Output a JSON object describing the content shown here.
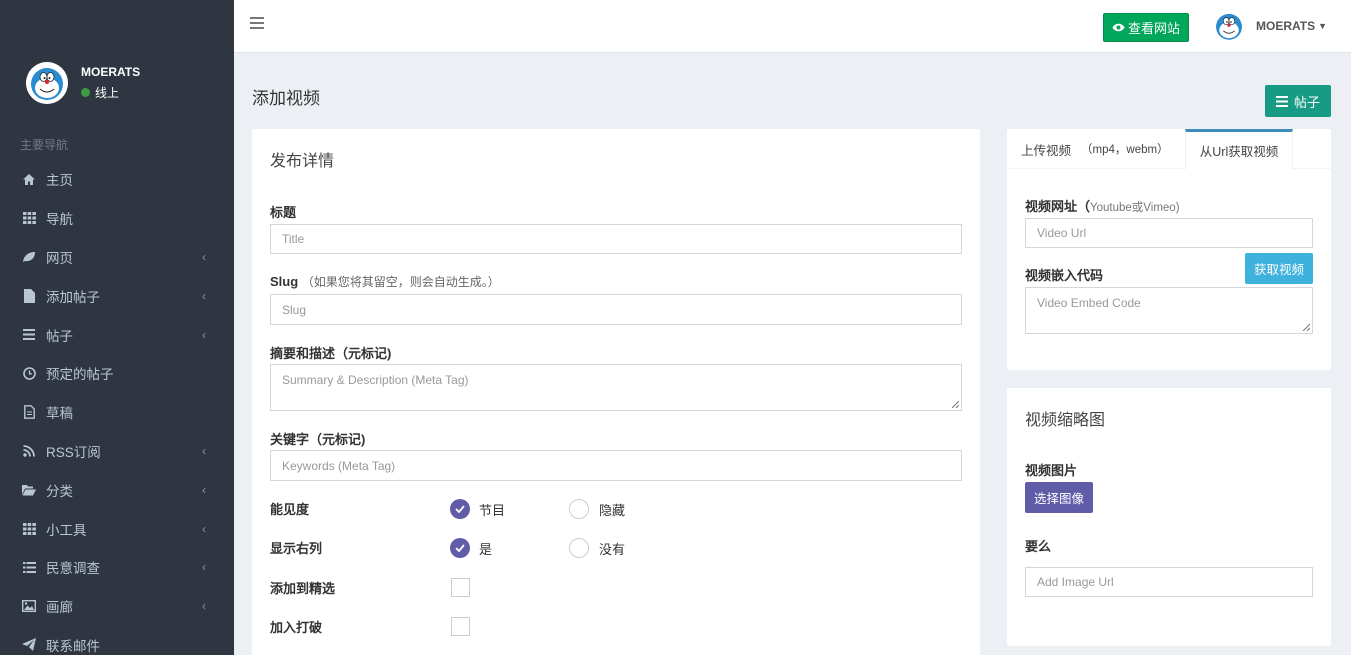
{
  "sidebar": {
    "user_name": "MOERATS",
    "status": "线上",
    "nav_header": "主要导航",
    "items": [
      {
        "label": "主页",
        "icon": "home-icon",
        "has_children": false
      },
      {
        "label": "导航",
        "icon": "grid-icon",
        "has_children": false
      },
      {
        "label": "网页",
        "icon": "leaf-icon",
        "has_children": true
      },
      {
        "label": "添加帖子",
        "icon": "file-icon",
        "has_children": true
      },
      {
        "label": "帖子",
        "icon": "bars-icon",
        "has_children": true
      },
      {
        "label": "预定的帖子",
        "icon": "clock-icon",
        "has_children": false
      },
      {
        "label": "草稿",
        "icon": "file-text-icon",
        "has_children": false
      },
      {
        "label": "RSS订阅",
        "icon": "rss-icon",
        "has_children": true
      },
      {
        "label": "分类",
        "icon": "folder-open-icon",
        "has_children": true
      },
      {
        "label": "小工具",
        "icon": "grid-icon",
        "has_children": true
      },
      {
        "label": "民意调查",
        "icon": "list-icon",
        "has_children": true
      },
      {
        "label": "画廊",
        "icon": "image-icon",
        "has_children": true
      },
      {
        "label": "联系邮件",
        "icon": "paper-plane-icon",
        "has_children": false
      }
    ]
  },
  "topbar": {
    "view_site_label": "查看网站",
    "user_name": "MOERATS"
  },
  "page": {
    "title": "添加视频",
    "posts_button": "帖子"
  },
  "form": {
    "box_title": "发布详情",
    "title_label": "标题",
    "title_placeholder": "Title",
    "slug_label": "Slug",
    "slug_hint": "（如果您将其留空，则会自动生成。）",
    "slug_placeholder": "Slug",
    "summary_label": "摘要和描述（元标记)",
    "summary_placeholder": "Summary & Description (Meta Tag)",
    "keywords_label": "关键字（元标记)",
    "keywords_placeholder": "Keywords (Meta Tag)",
    "visibility_label": "能见度",
    "visibility_options": [
      "节目",
      "隐藏"
    ],
    "visibility_selected": "节目",
    "right_column_label": "显示右列",
    "right_column_options": [
      "是",
      "没有"
    ],
    "right_column_selected": "是",
    "featured_label": "添加到精选",
    "featured_checked": false,
    "breaking_label": "加入打破",
    "breaking_checked": false
  },
  "video_panel": {
    "tab_upload": "上传视频",
    "tab_upload_formats": "（mp4，webm）",
    "tab_url": "从Url获取视频",
    "active_tab": "从Url获取视频",
    "video_url_label": "视频网址（",
    "video_url_hint": "Youtube或Vimeo)",
    "video_url_placeholder": "Video Url",
    "fetch_button": "获取视频",
    "embed_label": "视频嵌入代码",
    "embed_placeholder": "Video Embed Code"
  },
  "thumbnail_panel": {
    "title": "视频缩略图",
    "image_label": "视频图片",
    "select_button": "选择图像",
    "or_label": "要么",
    "image_url_placeholder": "Add Image Url"
  },
  "colors": {
    "sidebar_bg": "#2f3541",
    "success": "#00a65a",
    "teal": "#189b84",
    "purple": "#605ca8",
    "info": "#3fb1dd",
    "online": "#3c9b44"
  }
}
